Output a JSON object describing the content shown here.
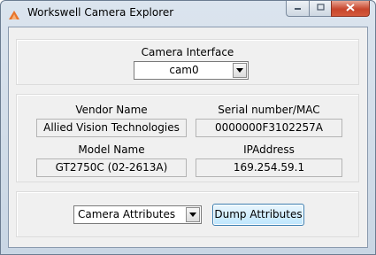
{
  "window": {
    "title": "Workswell Camera Explorer"
  },
  "camera_interface": {
    "label": "Camera Interface",
    "selected": "cam0"
  },
  "camera_info": {
    "vendor_label": "Vendor Name",
    "vendor_value": "Allied Vision Technologies",
    "serial_label": "Serial number/MAC",
    "serial_value": "0000000F3102257A",
    "model_label": "Model Name",
    "model_value": "GT2750C (02-2613A)",
    "ip_label": "IPAddress",
    "ip_value": "169.254.59.1"
  },
  "actions": {
    "attributes_selected": "Camera Attributes",
    "dump_button": "Dump Attributes"
  },
  "icons": {
    "app": "workswell-logo-icon",
    "minimize": "minimize-icon",
    "maximize": "maximize-icon",
    "close": "close-icon",
    "dropdown": "chevron-down-icon"
  },
  "colors": {
    "brand": "#e8742a",
    "close_button": "#c7452c",
    "button_border": "#3c7fb1"
  }
}
